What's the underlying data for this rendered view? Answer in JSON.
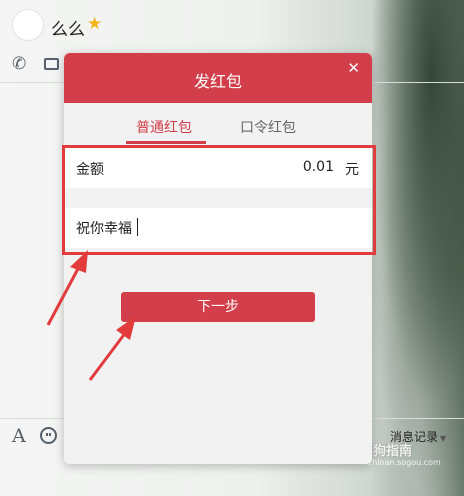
{
  "chat": {
    "contact_name": "么么",
    "history_label": "消息记录",
    "watermark": "搜狗指南",
    "watermark_sub": "zhinan.sogou.com"
  },
  "dialog": {
    "title": "发红包",
    "tabs": [
      {
        "label": "普通红包",
        "active": true
      },
      {
        "label": "口令红包",
        "active": false
      }
    ],
    "amount_label": "金额",
    "amount_value": "0.01",
    "amount_unit": "元",
    "blessing_value": "祝你幸福",
    "next_label": "下一步"
  },
  "icons": {
    "star": "star-icon",
    "phone": "phone-icon",
    "video": "video-icon",
    "font": "font-icon",
    "emoji": "emoji-icon",
    "close": "close-icon"
  },
  "colors": {
    "accent": "#d23f4a",
    "annotation": "#e23b3b"
  }
}
